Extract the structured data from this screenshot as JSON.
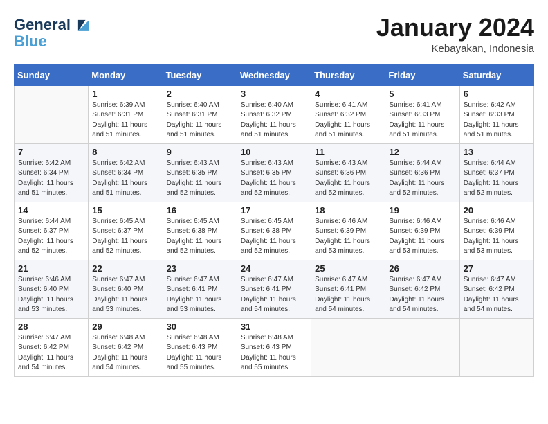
{
  "header": {
    "logo_line1": "General",
    "logo_line2": "Blue",
    "month_year": "January 2024",
    "location": "Kebayakan, Indonesia"
  },
  "weekdays": [
    "Sunday",
    "Monday",
    "Tuesday",
    "Wednesday",
    "Thursday",
    "Friday",
    "Saturday"
  ],
  "weeks": [
    [
      {
        "day": "",
        "sunrise": "",
        "sunset": "",
        "daylight": ""
      },
      {
        "day": "1",
        "sunrise": "Sunrise: 6:39 AM",
        "sunset": "Sunset: 6:31 PM",
        "daylight": "Daylight: 11 hours and 51 minutes."
      },
      {
        "day": "2",
        "sunrise": "Sunrise: 6:40 AM",
        "sunset": "Sunset: 6:31 PM",
        "daylight": "Daylight: 11 hours and 51 minutes."
      },
      {
        "day": "3",
        "sunrise": "Sunrise: 6:40 AM",
        "sunset": "Sunset: 6:32 PM",
        "daylight": "Daylight: 11 hours and 51 minutes."
      },
      {
        "day": "4",
        "sunrise": "Sunrise: 6:41 AM",
        "sunset": "Sunset: 6:32 PM",
        "daylight": "Daylight: 11 hours and 51 minutes."
      },
      {
        "day": "5",
        "sunrise": "Sunrise: 6:41 AM",
        "sunset": "Sunset: 6:33 PM",
        "daylight": "Daylight: 11 hours and 51 minutes."
      },
      {
        "day": "6",
        "sunrise": "Sunrise: 6:42 AM",
        "sunset": "Sunset: 6:33 PM",
        "daylight": "Daylight: 11 hours and 51 minutes."
      }
    ],
    [
      {
        "day": "7",
        "sunrise": "Sunrise: 6:42 AM",
        "sunset": "Sunset: 6:34 PM",
        "daylight": "Daylight: 11 hours and 51 minutes."
      },
      {
        "day": "8",
        "sunrise": "Sunrise: 6:42 AM",
        "sunset": "Sunset: 6:34 PM",
        "daylight": "Daylight: 11 hours and 51 minutes."
      },
      {
        "day": "9",
        "sunrise": "Sunrise: 6:43 AM",
        "sunset": "Sunset: 6:35 PM",
        "daylight": "Daylight: 11 hours and 52 minutes."
      },
      {
        "day": "10",
        "sunrise": "Sunrise: 6:43 AM",
        "sunset": "Sunset: 6:35 PM",
        "daylight": "Daylight: 11 hours and 52 minutes."
      },
      {
        "day": "11",
        "sunrise": "Sunrise: 6:43 AM",
        "sunset": "Sunset: 6:36 PM",
        "daylight": "Daylight: 11 hours and 52 minutes."
      },
      {
        "day": "12",
        "sunrise": "Sunrise: 6:44 AM",
        "sunset": "Sunset: 6:36 PM",
        "daylight": "Daylight: 11 hours and 52 minutes."
      },
      {
        "day": "13",
        "sunrise": "Sunrise: 6:44 AM",
        "sunset": "Sunset: 6:37 PM",
        "daylight": "Daylight: 11 hours and 52 minutes."
      }
    ],
    [
      {
        "day": "14",
        "sunrise": "Sunrise: 6:44 AM",
        "sunset": "Sunset: 6:37 PM",
        "daylight": "Daylight: 11 hours and 52 minutes."
      },
      {
        "day": "15",
        "sunrise": "Sunrise: 6:45 AM",
        "sunset": "Sunset: 6:37 PM",
        "daylight": "Daylight: 11 hours and 52 minutes."
      },
      {
        "day": "16",
        "sunrise": "Sunrise: 6:45 AM",
        "sunset": "Sunset: 6:38 PM",
        "daylight": "Daylight: 11 hours and 52 minutes."
      },
      {
        "day": "17",
        "sunrise": "Sunrise: 6:45 AM",
        "sunset": "Sunset: 6:38 PM",
        "daylight": "Daylight: 11 hours and 52 minutes."
      },
      {
        "day": "18",
        "sunrise": "Sunrise: 6:46 AM",
        "sunset": "Sunset: 6:39 PM",
        "daylight": "Daylight: 11 hours and 53 minutes."
      },
      {
        "day": "19",
        "sunrise": "Sunrise: 6:46 AM",
        "sunset": "Sunset: 6:39 PM",
        "daylight": "Daylight: 11 hours and 53 minutes."
      },
      {
        "day": "20",
        "sunrise": "Sunrise: 6:46 AM",
        "sunset": "Sunset: 6:39 PM",
        "daylight": "Daylight: 11 hours and 53 minutes."
      }
    ],
    [
      {
        "day": "21",
        "sunrise": "Sunrise: 6:46 AM",
        "sunset": "Sunset: 6:40 PM",
        "daylight": "Daylight: 11 hours and 53 minutes."
      },
      {
        "day": "22",
        "sunrise": "Sunrise: 6:47 AM",
        "sunset": "Sunset: 6:40 PM",
        "daylight": "Daylight: 11 hours and 53 minutes."
      },
      {
        "day": "23",
        "sunrise": "Sunrise: 6:47 AM",
        "sunset": "Sunset: 6:41 PM",
        "daylight": "Daylight: 11 hours and 53 minutes."
      },
      {
        "day": "24",
        "sunrise": "Sunrise: 6:47 AM",
        "sunset": "Sunset: 6:41 PM",
        "daylight": "Daylight: 11 hours and 54 minutes."
      },
      {
        "day": "25",
        "sunrise": "Sunrise: 6:47 AM",
        "sunset": "Sunset: 6:41 PM",
        "daylight": "Daylight: 11 hours and 54 minutes."
      },
      {
        "day": "26",
        "sunrise": "Sunrise: 6:47 AM",
        "sunset": "Sunset: 6:42 PM",
        "daylight": "Daylight: 11 hours and 54 minutes."
      },
      {
        "day": "27",
        "sunrise": "Sunrise: 6:47 AM",
        "sunset": "Sunset: 6:42 PM",
        "daylight": "Daylight: 11 hours and 54 minutes."
      }
    ],
    [
      {
        "day": "28",
        "sunrise": "Sunrise: 6:47 AM",
        "sunset": "Sunset: 6:42 PM",
        "daylight": "Daylight: 11 hours and 54 minutes."
      },
      {
        "day": "29",
        "sunrise": "Sunrise: 6:48 AM",
        "sunset": "Sunset: 6:42 PM",
        "daylight": "Daylight: 11 hours and 54 minutes."
      },
      {
        "day": "30",
        "sunrise": "Sunrise: 6:48 AM",
        "sunset": "Sunset: 6:43 PM",
        "daylight": "Daylight: 11 hours and 55 minutes."
      },
      {
        "day": "31",
        "sunrise": "Sunrise: 6:48 AM",
        "sunset": "Sunset: 6:43 PM",
        "daylight": "Daylight: 11 hours and 55 minutes."
      },
      {
        "day": "",
        "sunrise": "",
        "sunset": "",
        "daylight": ""
      },
      {
        "day": "",
        "sunrise": "",
        "sunset": "",
        "daylight": ""
      },
      {
        "day": "",
        "sunrise": "",
        "sunset": "",
        "daylight": ""
      }
    ]
  ]
}
